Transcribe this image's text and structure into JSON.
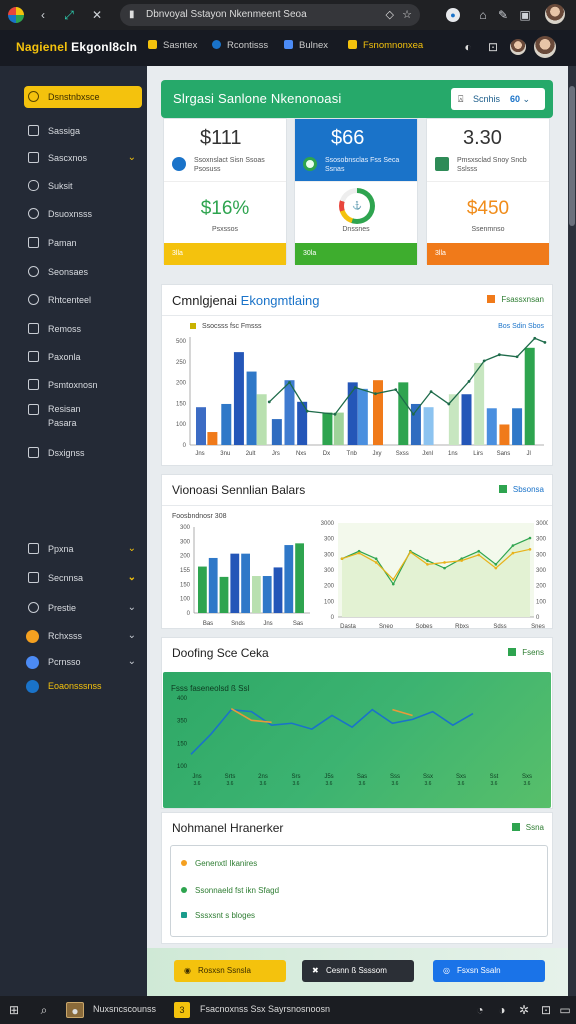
{
  "browser": {
    "address": "Dbnvoyal Sstayon Nkenmeent Seoa",
    "icons": [
      "back-icon",
      "refresh-icon",
      "extensions-icon",
      "lock-icon",
      "bookmark-icon",
      "star-icon",
      "profile-icon",
      "tab-icon",
      "edit-icon",
      "window-icon",
      "avatar"
    ]
  },
  "appbar": {
    "brand_a": "Nagienel",
    "brand_b": "Ekgonl8cln",
    "tabs": [
      {
        "label": "Sasntex",
        "color": "#f4c20d"
      },
      {
        "label": "Rcontisss",
        "color": "#1a73c9"
      },
      {
        "label": "Bulnex",
        "color": "#4c8bf5"
      },
      {
        "label": "Fsnomnonxea",
        "color": "#f4c20d"
      }
    ]
  },
  "sidebar": {
    "items": [
      {
        "label": "Dsnstnbxsce",
        "active": true
      },
      {
        "label": "Sassiga"
      },
      {
        "label": "Sascxnos",
        "chevron": true
      },
      {
        "label": "Suksit"
      },
      {
        "label": "Dsuoxnsss"
      },
      {
        "label": "Paman"
      },
      {
        "label": "Seonsaes"
      },
      {
        "label": "Rhtcenteel"
      },
      {
        "label": "Remoss"
      },
      {
        "label": "Paxonla"
      },
      {
        "label": "Psmtoxnosn"
      },
      {
        "label": "Resisan"
      },
      {
        "label": "Pasara"
      },
      {
        "label": "Dsxignss"
      }
    ],
    "lower": [
      {
        "label": "Ppxna",
        "chevron": "yellow"
      },
      {
        "label": "Secnnsa",
        "chevron": "yellow-bold"
      },
      {
        "label": "Prestie",
        "chevron": "gray"
      },
      {
        "label": "Rchxsss",
        "chevron": "gray",
        "dot": "#f4a020"
      },
      {
        "label": "Pcrnsso",
        "chevron": "gray",
        "dot": "#4c8bf5"
      },
      {
        "label": "Eoaonsssnss",
        "dot": "#1a73c9",
        "yellow": true
      }
    ]
  },
  "header": {
    "title": "Slrgasi Sanlone Nkenonoasi",
    "button_label": "Scnhis",
    "button_value": "60"
  },
  "kpis": [
    {
      "big": "$111",
      "lbl": "Ssoxnslact Sisn Ssoas Psosuss",
      "val": "$16%",
      "val_color": "#2ea44f",
      "sub": "Psxssos",
      "bar": "3lla",
      "bar_color": "#f4c20d",
      "top_color": "#fff",
      "icon_color": "#1a73c9"
    },
    {
      "big": "$66",
      "lbl": "Ssosobnsclas Fss Seca Ssnas",
      "val": "",
      "sub": "Dnssnes",
      "bar": "30la",
      "bar_color": "#3ead2e",
      "top_color": "#1a73c9",
      "icon_color": "#2ea44f"
    },
    {
      "big": "3.30",
      "lbl": "Pmsxsclad Snoy Sncb Sslsss",
      "val": "$450",
      "val_color": "#f08c1a",
      "sub": "Ssenmnso",
      "bar": "3lla",
      "bar_color": "#f07a1a",
      "top_color": "#fff",
      "icon_color": "#2e8b57"
    }
  ],
  "panel1": {
    "title_a": "Cmnlgjenai",
    "title_b": "Ekongmtlaing",
    "legend": "Fsassxnsan",
    "sublegend_left": "Ssocsss fsc Fmsss",
    "sublegend_right": "Bos Sdin Sbos"
  },
  "panel2": {
    "title": "Vionoasi Sennlian Balars",
    "legend": "Sbsonsa",
    "sublegend": "Foosbndnosr 308"
  },
  "panel3": {
    "title": "Doofing Sce Ceka",
    "legend": "Fsens",
    "inner_title": "Fsss faseneolsd ß Ssl"
  },
  "panel4": {
    "title": "Nohmanel Hranerker",
    "legend": "Ssna",
    "items": [
      {
        "label": "Genenxtl Ikanires",
        "color": "#f4a020"
      },
      {
        "label": "Ssonnaeld fst ikn Sfagd",
        "color": "#2ea44f"
      },
      {
        "label": "Sssxsnt s bloges",
        "color": "#1a9c8c"
      }
    ]
  },
  "footer_buttons": [
    {
      "label": "Rosxsn Ssnsla",
      "bg": "#f4c20d",
      "fg": "#3a2c00",
      "icon": "◉"
    },
    {
      "label": "Cesnn ß Ssssom",
      "bg": "#2b2f36",
      "fg": "#fff",
      "icon": "✖"
    },
    {
      "label": "Fsxsn Ssaln",
      "bg": "#1a73e8",
      "fg": "#fff",
      "icon": "◎"
    }
  ],
  "taskbar": {
    "label_a": "Nuxsncscounss",
    "label_b": "Fsacnoxnss Ssx Sayrsnosnoosn"
  },
  "chart_data": [
    {
      "type": "bar",
      "title": "Cmnlgjenai Ekongmtlaing",
      "categories": [
        "Jns",
        "3nu",
        "2ult",
        "Jrs",
        "Nxs",
        "Dx",
        "Tnb",
        "Jxy",
        "Sxss",
        "Jxnl",
        "1ns",
        "Lirs",
        "Sans",
        "Jl"
      ],
      "ylim": [
        0,
        1000
      ],
      "yticks": [
        "0",
        "100",
        "150",
        "200",
        "250",
        "500"
      ],
      "bars": [
        {
          "c": 0,
          "v": 350,
          "col": "#3c6cc4"
        },
        {
          "c": 0.45,
          "v": 120,
          "col": "#f07a1a"
        },
        {
          "c": 1,
          "v": 380,
          "col": "#2f78c8"
        },
        {
          "c": 1.5,
          "v": 860,
          "col": "#2456b8"
        },
        {
          "c": 2,
          "v": 680,
          "col": "#2f78c8"
        },
        {
          "c": 2.4,
          "v": 470,
          "col": "#b9e0b0"
        },
        {
          "c": 3,
          "v": 240,
          "col": "#2f6cc0"
        },
        {
          "c": 3.5,
          "v": 600,
          "col": "#3f7bd0"
        },
        {
          "c": 4,
          "v": 400,
          "col": "#2456b8"
        },
        {
          "c": 5,
          "v": 300,
          "col": "#2ea44f"
        },
        {
          "c": 5.45,
          "v": 300,
          "col": "#9fd39a"
        },
        {
          "c": 6,
          "v": 580,
          "col": "#2456b8"
        },
        {
          "c": 6.4,
          "v": 520,
          "col": "#4a8fdf"
        },
        {
          "c": 7,
          "v": 600,
          "col": "#f07a1a"
        },
        {
          "c": 8,
          "v": 580,
          "col": "#2ea44f"
        },
        {
          "c": 8.5,
          "v": 380,
          "col": "#2f6cc0"
        },
        {
          "c": 9,
          "v": 350,
          "col": "#8cc3f0"
        },
        {
          "c": 10,
          "v": 470,
          "col": "#c7e6c0"
        },
        {
          "c": 10.5,
          "v": 470,
          "col": "#2456b8"
        },
        {
          "c": 11,
          "v": 760,
          "col": "#c7e6c0"
        },
        {
          "c": 11.5,
          "v": 340,
          "col": "#4a8fdf"
        },
        {
          "c": 12,
          "v": 190,
          "col": "#f07a1a"
        },
        {
          "c": 12.5,
          "v": 340,
          "col": "#2f78c8"
        },
        {
          "c": 13,
          "v": 900,
          "col": "#2ea44f"
        }
      ],
      "line": [
        [
          2.7,
          420
        ],
        [
          3.5,
          610
        ],
        [
          4.2,
          330
        ],
        [
          5.3,
          300
        ],
        [
          6.1,
          560
        ],
        [
          6.9,
          500
        ],
        [
          7.7,
          540
        ],
        [
          8.4,
          300
        ],
        [
          9.1,
          520
        ],
        [
          9.8,
          400
        ],
        [
          10.6,
          620
        ],
        [
          11.2,
          820
        ],
        [
          11.8,
          880
        ],
        [
          12.5,
          860
        ],
        [
          13.2,
          1040
        ],
        [
          13.6,
          1000
        ]
      ]
    },
    {
      "type": "bar",
      "categories": [
        "Bas",
        "Snds",
        "Jns",
        "Sas"
      ],
      "ylim": [
        0,
        1000
      ],
      "yticks": [
        "0",
        "100",
        "150",
        "155",
        "200",
        "300",
        "300"
      ],
      "bars": [
        {
          "v": 540,
          "col": "#2ea44f"
        },
        {
          "v": 640,
          "col": "#2f78c8"
        },
        {
          "v": 420,
          "col": "#2ea44f"
        },
        {
          "v": 690,
          "col": "#2456b8"
        },
        {
          "v": 690,
          "col": "#2f78c8"
        },
        {
          "v": 430,
          "col": "#b9e0b0"
        },
        {
          "v": 430,
          "col": "#2f78c8"
        },
        {
          "v": 530,
          "col": "#2456b8"
        },
        {
          "v": 790,
          "col": "#2f78c8"
        },
        {
          "v": 810,
          "col": "#2ea44f"
        }
      ]
    },
    {
      "type": "line",
      "categories": [
        "Dasta",
        "Sneo",
        "Sobes",
        "Rbxs",
        "Sdss",
        "Snes"
      ],
      "yticks": [
        "0",
        "100",
        "200",
        "300",
        "300",
        "300",
        "3000"
      ],
      "series": [
        {
          "name": "green",
          "color": "#2ea44f",
          "values": [
            620,
            700,
            620,
            350,
            700,
            600,
            520,
            620,
            700,
            560,
            760,
            840
          ]
        },
        {
          "name": "yellow",
          "color": "#e8b21a",
          "values": [
            620,
            680,
            580,
            400,
            690,
            560,
            580,
            600,
            660,
            520,
            680,
            720
          ]
        }
      ]
    },
    {
      "type": "line",
      "categories": [
        "Jns",
        "Srts",
        "2ns",
        "Srs",
        "J5s",
        "Sas",
        "Sss",
        "Ssx",
        "Sxs",
        "Sst",
        "Sxs"
      ],
      "yticks": [
        "100",
        "150",
        "350",
        "400"
      ],
      "series": [
        {
          "name": "blue",
          "color": "#1a73c9",
          "values": [
            120,
            330,
            580,
            560,
            420,
            440,
            380,
            520,
            400,
            580,
            440,
            480,
            560,
            420,
            540
          ]
        },
        {
          "name": "orange",
          "color": "#e89a3a",
          "values": [
            null,
            null,
            590,
            470,
            450,
            null,
            null,
            null,
            null,
            null,
            580,
            520,
            null,
            null,
            null
          ]
        }
      ]
    }
  ]
}
